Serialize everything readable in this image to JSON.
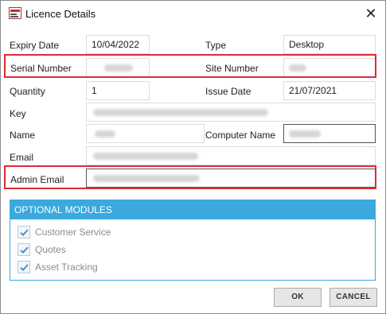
{
  "window": {
    "title": "Licence Details",
    "close_glyph": "✕",
    "app_icon": "licence-app-icon"
  },
  "fields": {
    "expiry_date": {
      "label": "Expiry Date",
      "value": "10/04/2022"
    },
    "type": {
      "label": "Type",
      "value": "Desktop"
    },
    "serial_number": {
      "label": "Serial Number",
      "value": ""
    },
    "site_number": {
      "label": "Site Number",
      "value": ""
    },
    "quantity": {
      "label": "Quantity",
      "value": "1"
    },
    "issue_date": {
      "label": "Issue Date",
      "value": "21/07/2021"
    },
    "key": {
      "label": "Key",
      "value": ""
    },
    "name": {
      "label": "Name",
      "value": ""
    },
    "computer_name": {
      "label": "Computer Name",
      "value": ""
    },
    "email": {
      "label": "Email",
      "value": ""
    },
    "admin_email": {
      "label": "Admin Email",
      "value": ""
    }
  },
  "optional_modules": {
    "header": "OPTIONAL MODULES",
    "items": [
      {
        "label": "Customer Service",
        "checked": true
      },
      {
        "label": "Quotes",
        "checked": true
      },
      {
        "label": "Asset Tracking",
        "checked": true
      }
    ]
  },
  "buttons": {
    "ok": "OK",
    "cancel": "CANCEL"
  },
  "colors": {
    "accent": "#3aa9de",
    "highlight": "#e02a36"
  }
}
